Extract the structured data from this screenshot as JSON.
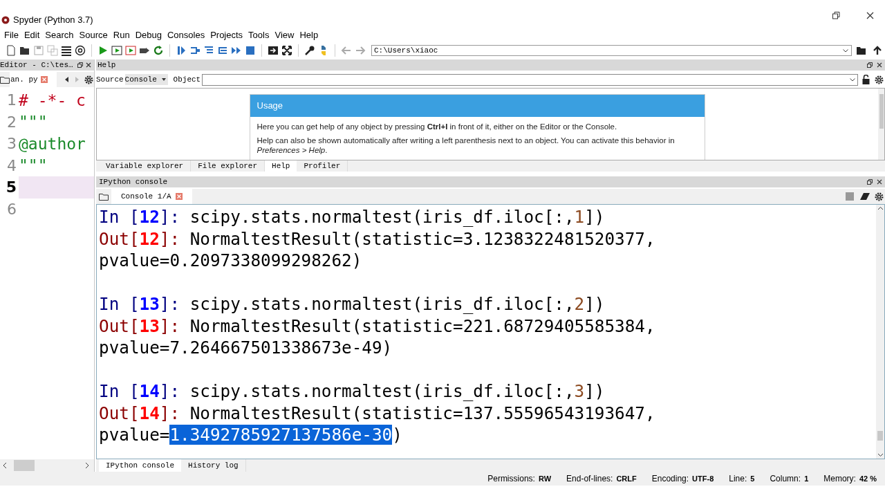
{
  "window": {
    "title": "Spyder (Python 3.7)"
  },
  "menu": [
    "File",
    "Edit",
    "Search",
    "Source",
    "Run",
    "Debug",
    "Consoles",
    "Projects",
    "Tools",
    "View",
    "Help"
  ],
  "toolbar": {
    "path": "C:\\Users\\xiaoc"
  },
  "editor": {
    "title": "Editor - C:\\tes…",
    "file_tab": "an. py",
    "lines": [
      {
        "number": "1",
        "current": false,
        "segments": [
          {
            "kind": "comment",
            "text": "# -*- c"
          }
        ]
      },
      {
        "number": "2",
        "current": false,
        "segments": [
          {
            "kind": "string",
            "text": "\"\"\""
          }
        ]
      },
      {
        "number": "3",
        "current": false,
        "segments": [
          {
            "kind": "string",
            "text": "@author"
          }
        ]
      },
      {
        "number": "4",
        "current": false,
        "segments": [
          {
            "kind": "string",
            "text": "\"\"\""
          }
        ]
      },
      {
        "number": "5",
        "current": true
      },
      {
        "number": "6",
        "current": false
      }
    ]
  },
  "help": {
    "title": "Help",
    "source_label": "Source",
    "source_value": "Console",
    "object_label": "Object",
    "usage_title": "Usage",
    "paragraphs": [
      "Here you can get help of any object by pressing **Ctrl+I** in front of it, either on the Editor or the Console.",
      "Help can also be shown automatically after writing a left parenthesis next to an object. You can activate this behavior in *Preferences > Help*."
    ],
    "tabs": [
      {
        "label": "Variable explorer",
        "selected": false
      },
      {
        "label": "File explorer",
        "selected": false
      },
      {
        "label": "Help",
        "selected": true
      },
      {
        "label": "Profiler",
        "selected": false
      }
    ]
  },
  "console": {
    "title": "IPython console",
    "tab": "Console 1/A",
    "blocks": [
      {
        "lines": [
          [
            {
              "kind": "in",
              "text": "In ["
            },
            {
              "kind": "in_num",
              "text": "12"
            },
            {
              "kind": "in",
              "text": "]: "
            },
            {
              "kind": "code",
              "text": "scipy.stats.normaltest(iris_df.iloc[:,"
            },
            {
              "kind": "number",
              "text": "1"
            },
            {
              "kind": "code",
              "text": "])"
            }
          ],
          [
            {
              "kind": "out",
              "text": "Out["
            },
            {
              "kind": "out_num",
              "text": "12"
            },
            {
              "kind": "out",
              "text": "]: "
            },
            {
              "kind": "code",
              "text": "NormaltestResult(statistic=3.1238322481520377,"
            }
          ],
          [
            {
              "kind": "code",
              "text": "pvalue=0.2097338099298262)"
            }
          ]
        ]
      },
      {
        "lines": [
          [
            {
              "kind": "in",
              "text": "In ["
            },
            {
              "kind": "in_num",
              "text": "13"
            },
            {
              "kind": "in",
              "text": "]: "
            },
            {
              "kind": "code",
              "text": "scipy.stats.normaltest(iris_df.iloc[:,"
            },
            {
              "kind": "number",
              "text": "2"
            },
            {
              "kind": "code",
              "text": "])"
            }
          ],
          [
            {
              "kind": "out",
              "text": "Out["
            },
            {
              "kind": "out_num",
              "text": "13"
            },
            {
              "kind": "out",
              "text": "]: "
            },
            {
              "kind": "code",
              "text": "NormaltestResult(statistic=221.68729405585384,"
            }
          ],
          [
            {
              "kind": "code",
              "text": "pvalue=7.264667501338673e-49)"
            }
          ]
        ]
      },
      {
        "lines": [
          [
            {
              "kind": "in",
              "text": "In ["
            },
            {
              "kind": "in_num",
              "text": "14"
            },
            {
              "kind": "in",
              "text": "]: "
            },
            {
              "kind": "code",
              "text": "scipy.stats.normaltest(iris_df.iloc[:,"
            },
            {
              "kind": "number",
              "text": "3"
            },
            {
              "kind": "code",
              "text": "])"
            }
          ],
          [
            {
              "kind": "out",
              "text": "Out["
            },
            {
              "kind": "out_num",
              "text": "14"
            },
            {
              "kind": "out",
              "text": "]: "
            },
            {
              "kind": "code",
              "text": "NormaltestResult(statistic=137.55596543193647,"
            }
          ],
          [
            {
              "kind": "code",
              "text": "pvalue="
            },
            {
              "kind": "selected",
              "text": "1.3492785927137586e-30"
            },
            {
              "kind": "code",
              "text": ")"
            }
          ]
        ]
      }
    ],
    "bottom_tabs": [
      {
        "label": "IPython console",
        "selected": true
      },
      {
        "label": "History log",
        "selected": false
      }
    ]
  },
  "status_bar": [
    {
      "label": "Permissions:",
      "value": "RW"
    },
    {
      "label": "End-of-lines:",
      "value": "CRLF"
    },
    {
      "label": "Encoding:",
      "value": "UTF-8"
    },
    {
      "label": "Line:",
      "value": "5"
    },
    {
      "label": "Column:",
      "value": "1"
    },
    {
      "label": "Memory:",
      "value": "42 %"
    }
  ]
}
